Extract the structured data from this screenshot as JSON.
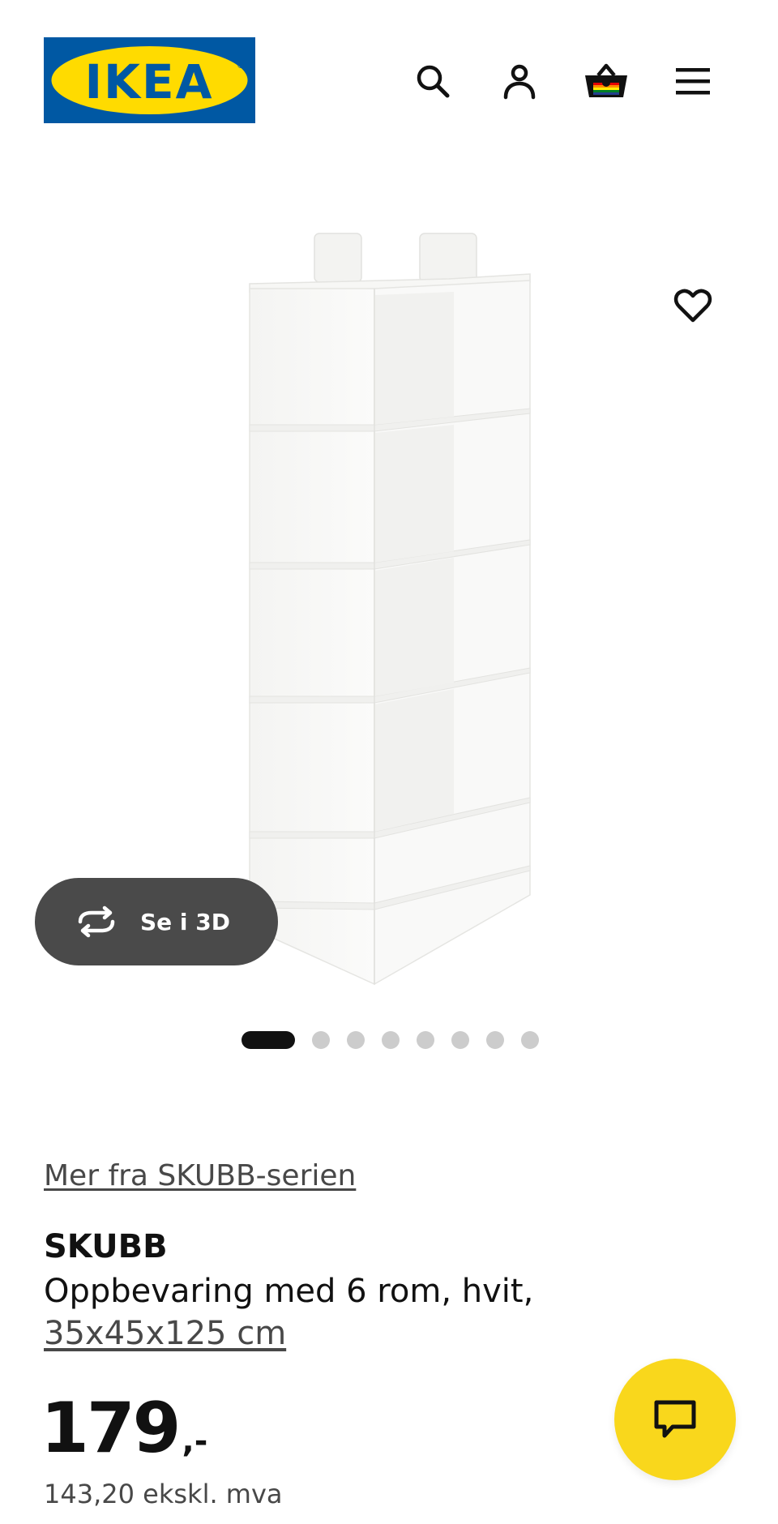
{
  "header": {
    "logo_text": "IKEA",
    "icons": [
      "search-icon",
      "profile-icon",
      "shopping-bag-icon",
      "hamburger-menu-icon"
    ],
    "brand_blue": "#0058a3",
    "brand_yellow": "#ffdb00"
  },
  "gallery": {
    "favorite_icon": "heart-icon",
    "view_3d_label": "Se i 3D",
    "view_3d_icon": "rotate-icon",
    "image_count": 8,
    "active_image_index": 0
  },
  "product": {
    "series_link": "Mer fra SKUBB-serien",
    "name": "SKUBB",
    "description": "Oppbevaring med 6 rom, hvit,",
    "size": "35x45x125 cm",
    "price_integer": "179",
    "price_suffix": ",-",
    "price_excl_vat": "143,20 ekskl. mva"
  },
  "chat": {
    "icon": "chat-bubble-icon",
    "color": "#f9d71c"
  }
}
